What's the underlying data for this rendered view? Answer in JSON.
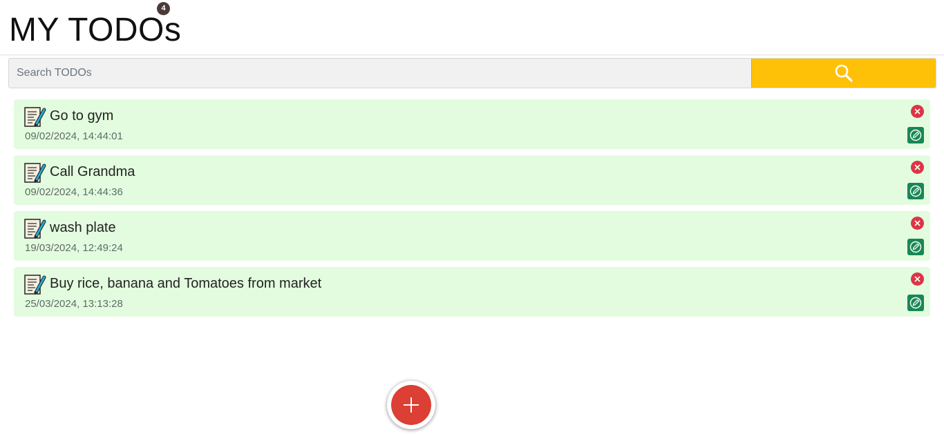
{
  "header": {
    "title": "MY TODOs",
    "count": "4"
  },
  "search": {
    "placeholder": "Search TODOs",
    "value": "",
    "button_icon": "search-icon",
    "button_color": "#ffc107"
  },
  "todos": [
    {
      "title": "Go to gym",
      "date": "09/02/2024, 14:44:01",
      "icon": "note-pencil-icon"
    },
    {
      "title": "Call Grandma",
      "date": "09/02/2024, 14:44:36",
      "icon": "note-pencil-icon"
    },
    {
      "title": "wash plate",
      "date": "19/03/2024, 12:49:24",
      "icon": "note-pencil-icon"
    },
    {
      "title": "Buy rice, banana and Tomatoes from market",
      "date": "25/03/2024, 13:13:28",
      "icon": "note-pencil-icon"
    }
  ],
  "actions": {
    "delete_icon": "close-icon",
    "edit_icon": "edit-icon",
    "add_icon": "plus-icon"
  },
  "colors": {
    "item_background": "#e3fcdf",
    "delete": "#dc3545",
    "edit": "#198754",
    "add": "#dc3f33",
    "badge": "#4a3b36"
  }
}
